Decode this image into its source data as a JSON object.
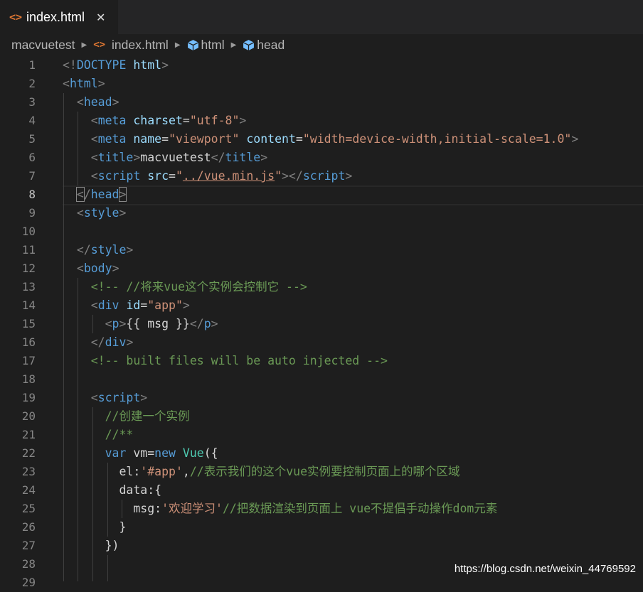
{
  "tab": {
    "icon": "<>",
    "label": "index.html",
    "close": "✕"
  },
  "breadcrumb": {
    "folder": "macvuetest",
    "file_icon": "<>",
    "file": "index.html",
    "sym1": "html",
    "sym2": "head"
  },
  "lines": [
    {
      "n": "1",
      "segs": [
        [
          "p",
          "<!"
        ],
        [
          "t",
          "DOCTYPE"
        ],
        [
          "v",
          " "
        ],
        [
          "a",
          "html"
        ],
        [
          "p",
          ">"
        ]
      ]
    },
    {
      "n": "2",
      "segs": [
        [
          "p",
          "<"
        ],
        [
          "t",
          "html"
        ],
        [
          "p",
          ">"
        ]
      ]
    },
    {
      "n": "3",
      "segs": [
        [
          "v",
          "  "
        ],
        [
          "p",
          "<"
        ],
        [
          "t",
          "head"
        ],
        [
          "p",
          ">"
        ]
      ]
    },
    {
      "n": "4",
      "segs": [
        [
          "v",
          "    "
        ],
        [
          "p",
          "<"
        ],
        [
          "t",
          "meta"
        ],
        [
          "v",
          " "
        ],
        [
          "a",
          "charset"
        ],
        [
          "v",
          "="
        ],
        [
          "s",
          "\"utf-8\""
        ],
        [
          "p",
          ">"
        ]
      ]
    },
    {
      "n": "5",
      "segs": [
        [
          "v",
          "    "
        ],
        [
          "p",
          "<"
        ],
        [
          "t",
          "meta"
        ],
        [
          "v",
          " "
        ],
        [
          "a",
          "name"
        ],
        [
          "v",
          "="
        ],
        [
          "s",
          "\"viewport\""
        ],
        [
          "v",
          " "
        ],
        [
          "a",
          "content"
        ],
        [
          "v",
          "="
        ],
        [
          "s",
          "\"width=device-width,initial-scale=1.0\""
        ],
        [
          "p",
          ">"
        ]
      ]
    },
    {
      "n": "6",
      "segs": [
        [
          "v",
          "    "
        ],
        [
          "p",
          "<"
        ],
        [
          "t",
          "title"
        ],
        [
          "p",
          ">"
        ],
        [
          "v",
          "macvuetest"
        ],
        [
          "p",
          "</"
        ],
        [
          "t",
          "title"
        ],
        [
          "p",
          ">"
        ]
      ]
    },
    {
      "n": "7",
      "segs": [
        [
          "v",
          "    "
        ],
        [
          "p",
          "<"
        ],
        [
          "t",
          "script"
        ],
        [
          "v",
          " "
        ],
        [
          "a",
          "src"
        ],
        [
          "v",
          "="
        ],
        [
          "s",
          "\""
        ],
        [
          "su",
          "../vue.min.js"
        ],
        [
          "s",
          "\""
        ],
        [
          "p",
          "></"
        ],
        [
          "t",
          "script"
        ],
        [
          "p",
          ">"
        ]
      ]
    },
    {
      "n": "8",
      "segs": [
        [
          "v",
          "  "
        ],
        [
          "pbm",
          "<"
        ],
        [
          "p",
          "/"
        ],
        [
          "t",
          "head"
        ],
        [
          "pbm",
          ">"
        ]
      ],
      "active": true
    },
    {
      "n": "9",
      "segs": [
        [
          "v",
          "  "
        ],
        [
          "p",
          "<"
        ],
        [
          "t",
          "style"
        ],
        [
          "p",
          ">"
        ]
      ]
    },
    {
      "n": "10",
      "segs": []
    },
    {
      "n": "11",
      "segs": [
        [
          "v",
          "  "
        ],
        [
          "p",
          "</"
        ],
        [
          "t",
          "style"
        ],
        [
          "p",
          ">"
        ]
      ]
    },
    {
      "n": "12",
      "segs": [
        [
          "v",
          "  "
        ],
        [
          "p",
          "<"
        ],
        [
          "t",
          "body"
        ],
        [
          "p",
          ">"
        ]
      ]
    },
    {
      "n": "13",
      "segs": [
        [
          "v",
          "    "
        ],
        [
          "c",
          "<!-- //将来vue这个实例会控制它 -->"
        ]
      ]
    },
    {
      "n": "14",
      "segs": [
        [
          "v",
          "    "
        ],
        [
          "p",
          "<"
        ],
        [
          "t",
          "div"
        ],
        [
          "v",
          " "
        ],
        [
          "a",
          "id"
        ],
        [
          "v",
          "="
        ],
        [
          "s",
          "\"app\""
        ],
        [
          "p",
          ">"
        ]
      ]
    },
    {
      "n": "15",
      "segs": [
        [
          "v",
          "      "
        ],
        [
          "p",
          "<"
        ],
        [
          "t",
          "p"
        ],
        [
          "p",
          ">"
        ],
        [
          "v",
          "{{ msg }}"
        ],
        [
          "p",
          "</"
        ],
        [
          "t",
          "p"
        ],
        [
          "p",
          ">"
        ]
      ]
    },
    {
      "n": "16",
      "segs": [
        [
          "v",
          "    "
        ],
        [
          "p",
          "</"
        ],
        [
          "t",
          "div"
        ],
        [
          "p",
          ">"
        ]
      ]
    },
    {
      "n": "17",
      "segs": [
        [
          "v",
          "    "
        ],
        [
          "c",
          "<!-- built files will be auto injected -->"
        ]
      ]
    },
    {
      "n": "18",
      "segs": []
    },
    {
      "n": "19",
      "segs": [
        [
          "v",
          "    "
        ],
        [
          "p",
          "<"
        ],
        [
          "t",
          "script"
        ],
        [
          "p",
          ">"
        ]
      ]
    },
    {
      "n": "20",
      "segs": [
        [
          "v",
          "      "
        ],
        [
          "c",
          "//创建一个实例"
        ]
      ]
    },
    {
      "n": "21",
      "segs": [
        [
          "v",
          "      "
        ],
        [
          "c",
          "//**"
        ]
      ]
    },
    {
      "n": "22",
      "segs": [
        [
          "v",
          "      "
        ],
        [
          "k",
          "var"
        ],
        [
          "v",
          " vm="
        ],
        [
          "k",
          "new"
        ],
        [
          "v",
          " "
        ],
        [
          "cls",
          "Vue"
        ],
        [
          "v",
          "({"
        ]
      ]
    },
    {
      "n": "23",
      "segs": [
        [
          "v",
          "        el:"
        ],
        [
          "s",
          "'#app'"
        ],
        [
          "v",
          ","
        ],
        [
          "c",
          "//表示我们的这个vue实例要控制页面上的哪个区域"
        ]
      ]
    },
    {
      "n": "24",
      "segs": [
        [
          "v",
          "        data:{"
        ]
      ]
    },
    {
      "n": "25",
      "segs": [
        [
          "v",
          "          msg:"
        ],
        [
          "s",
          "'欢迎学习'"
        ],
        [
          "c",
          "//把数据渲染到页面上 vue不提倡手动操作dom元素"
        ]
      ]
    },
    {
      "n": "26",
      "segs": [
        [
          "v",
          "        }"
        ]
      ]
    },
    {
      "n": "27",
      "segs": [
        [
          "v",
          "      })"
        ]
      ]
    },
    {
      "n": "28",
      "segs": []
    },
    {
      "n": "29",
      "segs": []
    }
  ],
  "watermark": "https://blog.csdn.net/weixin_44769592",
  "colors": {
    "background": "#1e1e1e",
    "tag": "#569cd6",
    "attribute": "#9cdcfe",
    "string": "#ce9178",
    "comment": "#6a9955",
    "class": "#4ec9b0"
  }
}
